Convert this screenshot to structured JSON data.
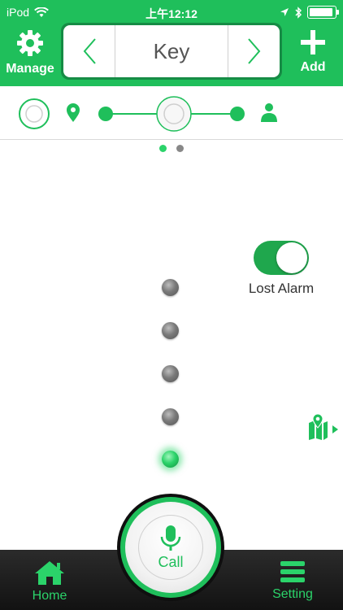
{
  "status_bar": {
    "carrier": "iPod",
    "time": "上午12:12"
  },
  "header": {
    "manage_label": "Manage",
    "add_label": "Add",
    "title": "Key"
  },
  "pager": {
    "pages": 2,
    "active_index": 0
  },
  "alarm": {
    "label": "Lost Alarm",
    "enabled": true
  },
  "signal": {
    "levels_total": 5,
    "levels_active": 1
  },
  "bottom_bar": {
    "home_label": "Home",
    "call_label": "Call",
    "setting_label": "Setting"
  },
  "colors": {
    "accent": "#1fbf5b",
    "accent_dark": "#168c45",
    "tab_bar": "#1a1a1a"
  }
}
